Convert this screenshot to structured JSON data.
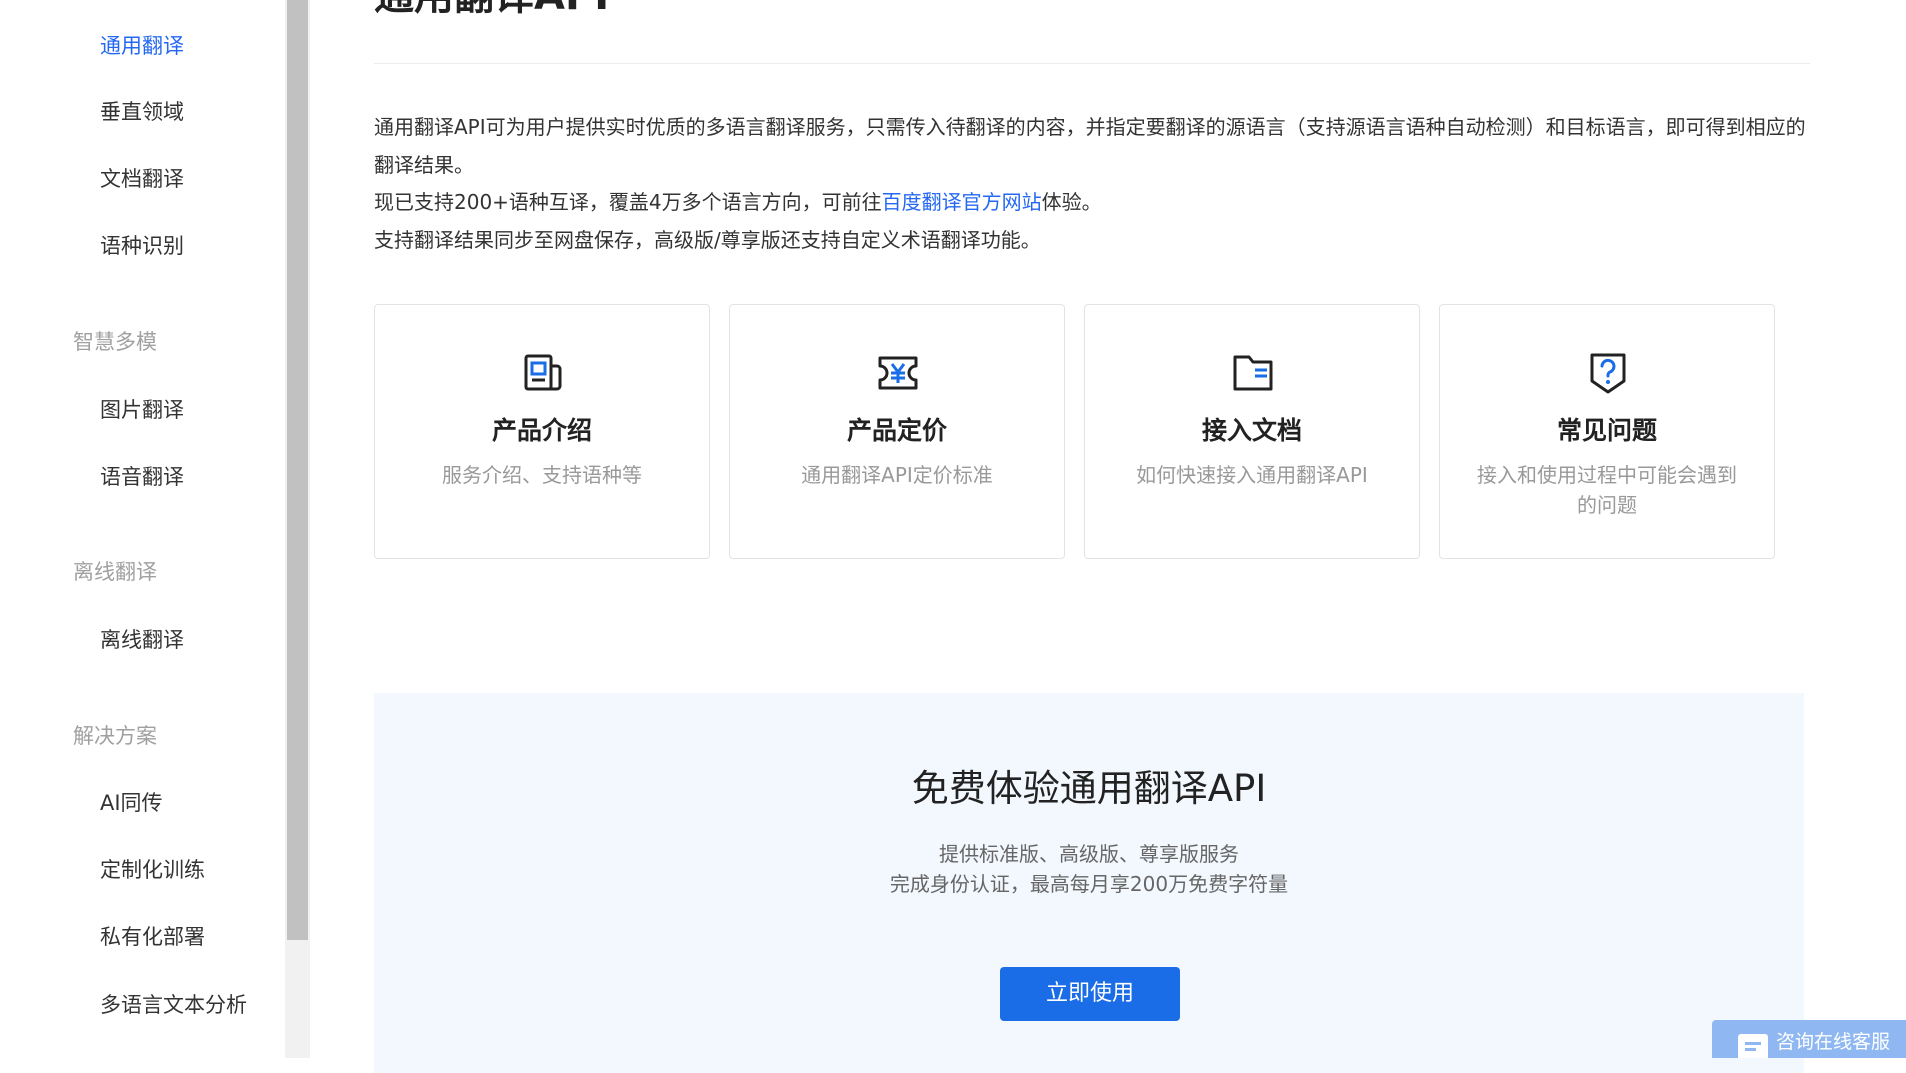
{
  "sidebar": {
    "items": [
      {
        "label": "通用翻译",
        "active": true
      },
      {
        "label": "垂直领域"
      },
      {
        "label": "文档翻译"
      },
      {
        "label": "语种识别"
      }
    ],
    "groups": [
      {
        "title": "智慧多模",
        "items": [
          {
            "label": "图片翻译"
          },
          {
            "label": "语音翻译"
          }
        ]
      },
      {
        "title": "离线翻译",
        "items": [
          {
            "label": "离线翻译"
          }
        ]
      },
      {
        "title": "解决方案",
        "items": [
          {
            "label": "AI同传"
          },
          {
            "label": "定制化训练"
          },
          {
            "label": "私有化部署"
          },
          {
            "label": "多语言文本分析"
          }
        ]
      }
    ]
  },
  "main": {
    "title": "通用翻译API",
    "intro": {
      "p1": "通用翻译API可为用户提供实时优质的多语言翻译服务，只需传入待翻译的内容，并指定要翻译的源语言（支持源语言语种自动检测）和目标语言，即可得到相应的翻译结果。",
      "p2_before": "现已支持200+语种互译，覆盖4万多个语言方向，可前往",
      "p2_link": "百度翻译官方网站",
      "p2_after": "体验。",
      "p3": "支持翻译结果同步至网盘保存，高级版/尊享版还支持自定义术语翻译功能。"
    },
    "cards": [
      {
        "icon": "product-intro-icon",
        "title": "产品介绍",
        "desc": "服务介绍、支持语种等"
      },
      {
        "icon": "pricing-icon",
        "title": "产品定价",
        "desc": "通用翻译API定价标准"
      },
      {
        "icon": "document-folder-icon",
        "title": "接入文档",
        "desc": "如何快速接入通用翻译API"
      },
      {
        "icon": "faq-icon",
        "title": "常见问题",
        "desc": "接入和使用过程中可能会遇到的问题"
      }
    ],
    "trial": {
      "title": "免费体验通用翻译API",
      "sub1": "提供标准版、高级版、尊享版服务",
      "sub2": "完成身份认证，最高每月享200万免费字符量",
      "button": "立即使用"
    }
  },
  "consult": {
    "label": "咨询在线客服"
  },
  "colors": {
    "accent": "#2468f2",
    "button": "#1a6de6",
    "trial_bg": "#f3f8fe",
    "consult_bg": "#8fb8f2"
  }
}
